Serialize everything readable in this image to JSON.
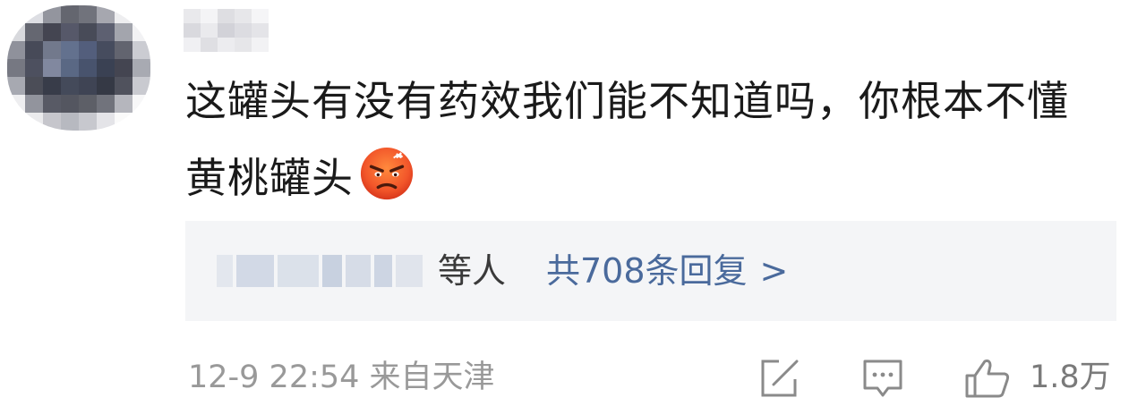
{
  "comment": {
    "text": "这罐头有没有药效我们能不知道吗，你根本不懂黄桃罐头",
    "emoji": "angry-face-emoji"
  },
  "reply_preview": {
    "suffix": "等人",
    "count_label": "共708条回复",
    "chevron": ">"
  },
  "footer": {
    "timestamp": "12-9 22:54 来自天津",
    "like_count": "1.8万"
  },
  "icons": {
    "share": "share-icon",
    "reply": "comment-icon",
    "like": "thumbs-up-icon"
  },
  "colors": {
    "link": "#4a6a9c",
    "muted": "#999999",
    "reply_bg": "#f4f5f7"
  }
}
